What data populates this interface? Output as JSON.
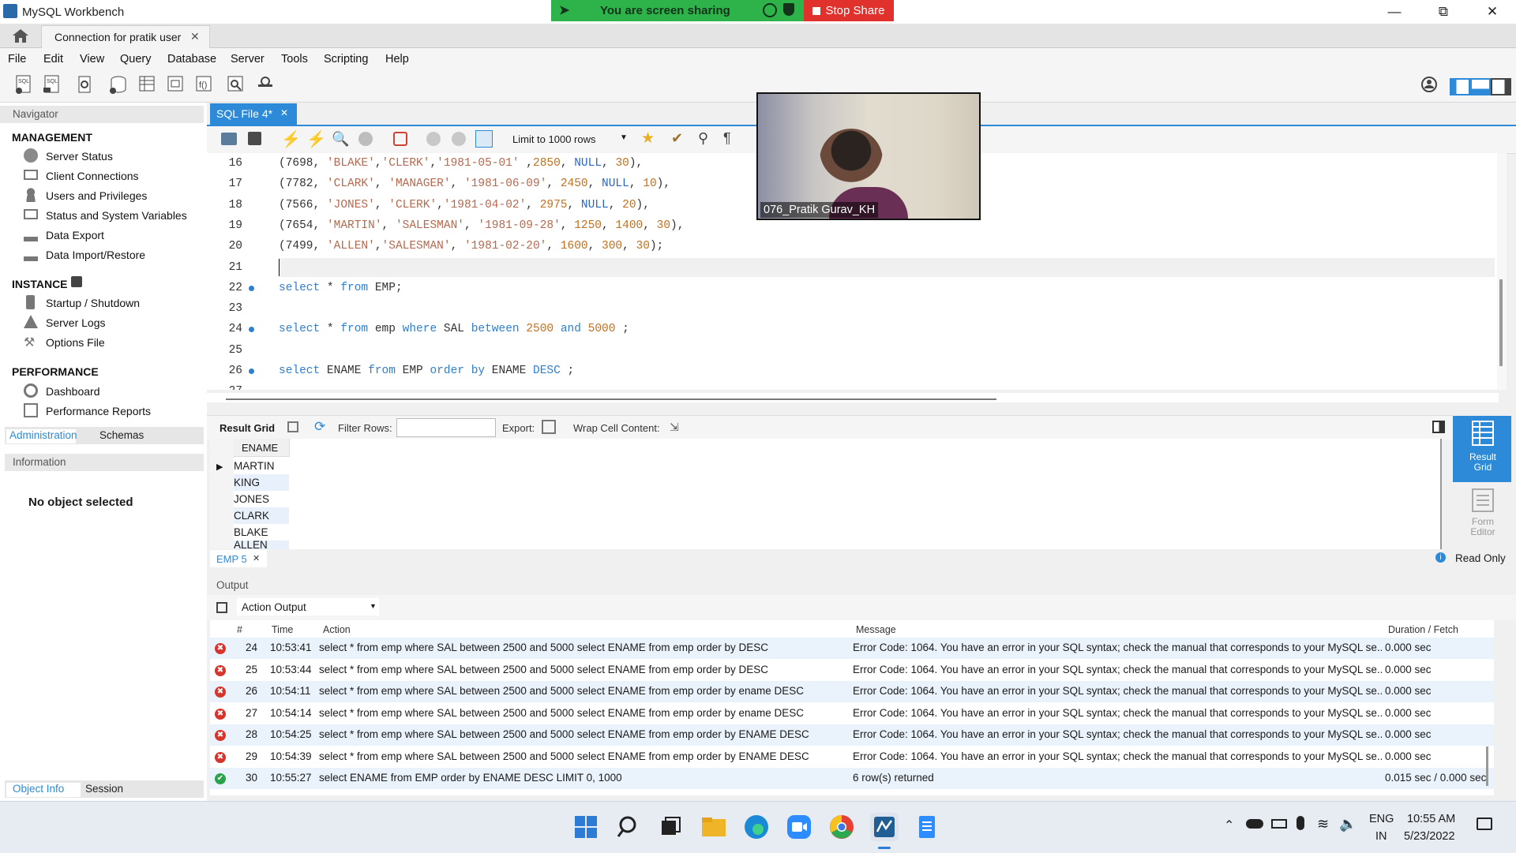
{
  "window": {
    "title": "MySQL Workbench"
  },
  "share": {
    "status": "You are screen sharing",
    "stop_label": "Stop Share"
  },
  "connection_tab": {
    "label": "Connection for pratik user"
  },
  "menu": [
    "File",
    "Edit",
    "View",
    "Query",
    "Database",
    "Server",
    "Tools",
    "Scripting",
    "Help"
  ],
  "navigator": {
    "title": "Navigator",
    "management": {
      "title": "MANAGEMENT",
      "items": [
        "Server Status",
        "Client Connections",
        "Users and Privileges",
        "Status and System Variables",
        "Data Export",
        "Data Import/Restore"
      ]
    },
    "instance": {
      "title": "INSTANCE",
      "items": [
        "Startup / Shutdown",
        "Server Logs",
        "Options File"
      ]
    },
    "performance": {
      "title": "PERFORMANCE",
      "items": [
        "Dashboard",
        "Performance Reports"
      ]
    },
    "tabs": [
      "Administration",
      "Schemas"
    ],
    "information_title": "Information",
    "no_object": "No object selected",
    "bottom_tabs": [
      "Object Info",
      "Session"
    ]
  },
  "editor": {
    "tab_label": "SQL File 4*",
    "limit_label": "Limit to 1000 rows",
    "lines": [
      {
        "n": "16",
        "dot": false,
        "html": "(7698, <s>'BLAKE'</s>,<s>'CLERK'</s>,<s>'1981-05-01'</s> ,<m>2850</m>, <u>NULL</u>, <m>30</m>),"
      },
      {
        "n": "17",
        "dot": false,
        "html": "(7782, <s>'CLARK'</s>, <s>'MANAGER'</s>, <s>'1981-06-09'</s>, <m>2450</m>, <u>NULL</u>, <m>10</m>),"
      },
      {
        "n": "18",
        "dot": false,
        "html": "(7566, <s>'JONES'</s>, <s>'CLERK'</s>,<s>'1981-04-02'</s>, <m>2975</m>, <u>NULL</u>, <m>20</m>),"
      },
      {
        "n": "19",
        "dot": false,
        "html": "(7654, <s>'MARTIN'</s>, <s>'SALESMAN'</s>, <s>'1981-09-28'</s>, <m>1250</m>, <m>1400</m>, <m>30</m>),"
      },
      {
        "n": "20",
        "dot": false,
        "html": "(7499, <s>'ALLEN'</s>,<s>'SALESMAN'</s>, <s>'1981-02-20'</s>, <m>1600</m>, <m>300</m>, <m>30</m>);"
      },
      {
        "n": "21",
        "dot": false,
        "html": ""
      },
      {
        "n": "22",
        "dot": true,
        "html": "<k>select</k> * <k>from</k> EMP;"
      },
      {
        "n": "23",
        "dot": false,
        "html": ""
      },
      {
        "n": "24",
        "dot": true,
        "html": "<k>select</k> * <k>from</k> emp <k>where</k> SAL <k>between</k> <m>2500</m> <k>and</k> <m>5000</m> ;"
      },
      {
        "n": "25",
        "dot": false,
        "html": ""
      },
      {
        "n": "26",
        "dot": true,
        "html": "<k>select</k> ENAME <k>from</k> EMP <k>order</k> <k>by</k> ENAME <k>DESC</k> ;"
      },
      {
        "n": "27",
        "dot": false,
        "html": ""
      }
    ]
  },
  "video": {
    "name": "076_Pratik Gurav_KH"
  },
  "result": {
    "grid_label": "Result Grid",
    "filter_label": "Filter Rows:",
    "export_label": "Export:",
    "wrap_label": "Wrap Cell Content:",
    "column": "ENAME",
    "rows": [
      "MARTIN",
      "KING",
      "JONES",
      "CLARK",
      "BLAKE",
      "ALLEN"
    ],
    "tab_label": "EMP 5",
    "side_result_grid": "Result Grid",
    "side_form_editor": "Form Editor",
    "read_only": "Read Only"
  },
  "output": {
    "title": "Output",
    "selector": "Action Output",
    "headers": [
      "#",
      "Time",
      "Action",
      "Message",
      "Duration / Fetch"
    ],
    "rows": [
      {
        "status": "error",
        "n": "24",
        "time": "10:53:41",
        "action": "select * from emp where SAL between 2500 and 5000   select ENAME from emp order by DESC",
        "message": "Error Code: 1064. You have an error in your SQL syntax; check the manual that corresponds to your MySQL se...",
        "duration": "0.000 sec"
      },
      {
        "status": "error",
        "n": "25",
        "time": "10:53:44",
        "action": "select * from emp where SAL between 2500 and 5000   select ENAME from emp order by DESC",
        "message": "Error Code: 1064. You have an error in your SQL syntax; check the manual that corresponds to your MySQL se...",
        "duration": "0.000 sec"
      },
      {
        "status": "error",
        "n": "26",
        "time": "10:54:11",
        "action": "select * from emp where SAL between 2500 and 5000   select ENAME from emp order by ename DESC",
        "message": "Error Code: 1064. You have an error in your SQL syntax; check the manual that corresponds to your MySQL se...",
        "duration": "0.000 sec"
      },
      {
        "status": "error",
        "n": "27",
        "time": "10:54:14",
        "action": "select * from emp where SAL between 2500 and 5000   select ENAME from emp order by ename DESC",
        "message": "Error Code: 1064. You have an error in your SQL syntax; check the manual that corresponds to your MySQL se...",
        "duration": "0.000 sec"
      },
      {
        "status": "error",
        "n": "28",
        "time": "10:54:25",
        "action": "select * from emp where SAL between 2500 and 5000   select ENAME from emp order by ENAME DESC",
        "message": "Error Code: 1064. You have an error in your SQL syntax; check the manual that corresponds to your MySQL se...",
        "duration": "0.000 sec"
      },
      {
        "status": "error",
        "n": "29",
        "time": "10:54:39",
        "action": "select * from emp where SAL between 2500 and 5000   select ENAME from emp order by ENAME DESC",
        "message": "Error Code: 1064. You have an error in your SQL syntax; check the manual that corresponds to your MySQL se...",
        "duration": "0.000 sec"
      },
      {
        "status": "ok",
        "n": "30",
        "time": "10:55:27",
        "action": "select ENAME from EMP order by ENAME DESC LIMIT 0, 1000",
        "message": "6 row(s) returned",
        "duration": "0.015 sec / 0.000 sec"
      }
    ]
  },
  "taskbar": {
    "lang": "ENG",
    "region": "IN",
    "time": "10:55 AM",
    "date": "5/23/2022"
  },
  "colors": {
    "accent": "#2c8ad8",
    "error": "#d9342b",
    "ok": "#2aa34a",
    "share_green": "#2db34a",
    "stop_red": "#e0312d"
  }
}
